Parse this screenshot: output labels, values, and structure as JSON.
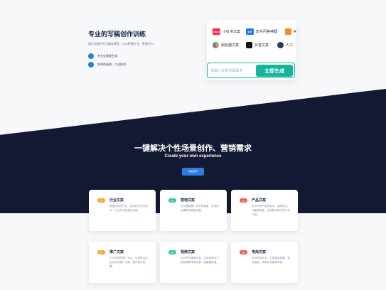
{
  "intro": {
    "title": "专业的写稿创作训练",
    "description": "通过海量的专业精准模型，让AI更懂专业、更懂用户。",
    "bullets": [
      "专业化智能生成",
      "效率的高效、口语贴切"
    ]
  },
  "tools": [
    {
      "label": "小红书文案",
      "icon_text": "小红书",
      "color": "#ff2442"
    },
    {
      "label": "知乎问答神器",
      "icon_text": "知乎",
      "color": "#1772f6"
    },
    {
      "label": "AI",
      "icon_text": "",
      "color": "#ff8a1f"
    },
    {
      "label": "朋友圈文案",
      "icon_text": "",
      "color": "#3cc36b"
    },
    {
      "label": "抖音文案",
      "icon_text": "♪",
      "color": "#111111"
    },
    {
      "label": "人工",
      "icon_text": "",
      "color": "#2a3b4c"
    }
  ],
  "search": {
    "placeholder": "请输入关键词或需求",
    "button_label": "立即生成"
  },
  "band": {
    "title": "一键解决个性场景创作、营销需求",
    "subtitle": "Create your own experience",
    "button_label": "开始创作"
  },
  "cards": [
    {
      "badge": "行业",
      "badge_color": "#f5a623",
      "title": "行业文案",
      "description": "根据不同的行业，生成符合行业特点、行业专业性高的文案。"
    },
    {
      "badge": "营销",
      "badge_color": "#2fc59c",
      "title": "营销文案",
      "description": "针对营销推广的不同场景，生成符合需求的营销文案。"
    },
    {
      "badge": "产品",
      "badge_color": "#ef5b5b",
      "title": "产品文案",
      "description": "针对不同产品的卖点、品牌定位、功能特性等，生成吸引用户的产品介绍。"
    },
    {
      "badge": "推广",
      "badge_color": "#f5a623",
      "title": "推广文案",
      "description": "针对不同的推广平台，生成符合平台特点的推广文案，提升转化效果。"
    },
    {
      "badge": "视频",
      "badge_color": "#2fc59c",
      "title": "视频文案",
      "description": "针对不同视频平台，生成有吸引力的视频脚本和文案，提高播放量。"
    },
    {
      "badge": "电商",
      "badge_color": "#ef5b5b",
      "title": "电商文案",
      "description": "针对电商平台，生成商品标题、卖点描述、详情页文案等内容。"
    }
  ]
}
